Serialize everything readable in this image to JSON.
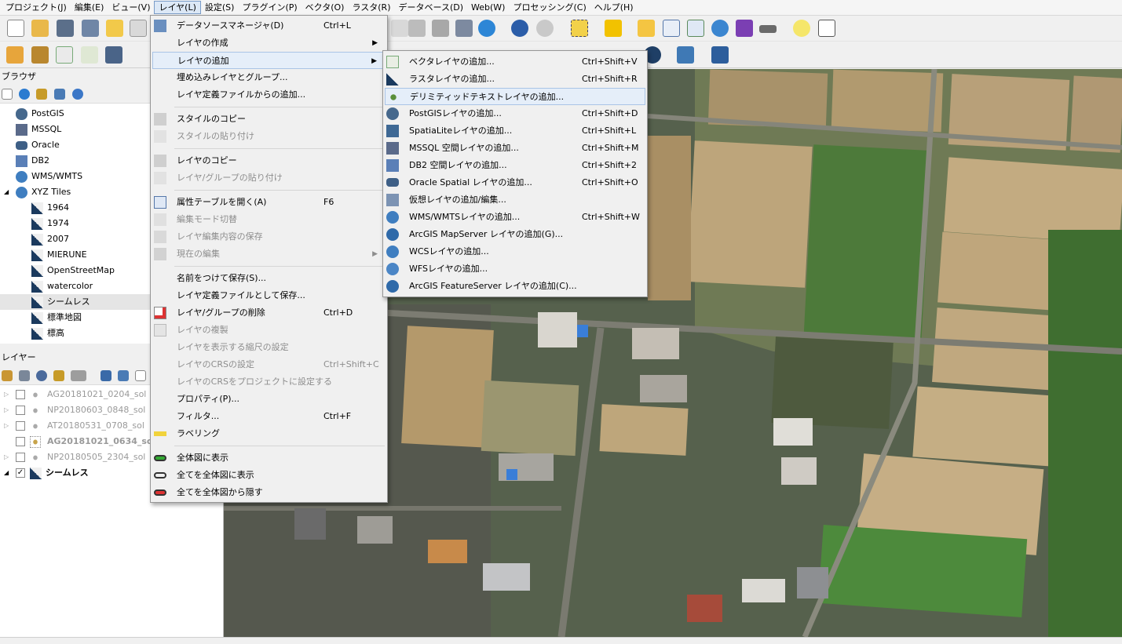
{
  "menubar": [
    "プロジェクト(J)",
    "編集(E)",
    "ビュー(V)",
    "レイヤ(L)",
    "設定(S)",
    "プラグイン(P)",
    "ベクタ(O)",
    "ラスタ(R)",
    "データベース(D)",
    "Web(W)",
    "プロセッシング(C)",
    "ヘルプ(H)"
  ],
  "browser": {
    "title": "ブラウザ",
    "items": [
      {
        "label": "PostGIS",
        "icon": "postgis-icon"
      },
      {
        "label": "MSSQL",
        "icon": "mssql-icon"
      },
      {
        "label": "Oracle",
        "icon": "oracle-icon"
      },
      {
        "label": "DB2",
        "icon": "db2-icon"
      },
      {
        "label": "WMS/WMTS",
        "icon": "globe-icon"
      },
      {
        "label": "XYZ Tiles",
        "icon": "globe-icon"
      },
      {
        "label": "1964",
        "icon": "tile-icon"
      },
      {
        "label": "1974",
        "icon": "tile-icon"
      },
      {
        "label": "2007",
        "icon": "tile-icon"
      },
      {
        "label": "MIERUNE",
        "icon": "tile-icon"
      },
      {
        "label": "OpenStreetMap",
        "icon": "tile-icon"
      },
      {
        "label": "watercolor",
        "icon": "tile-icon"
      },
      {
        "label": "シームレス",
        "icon": "tile-icon"
      },
      {
        "label": "標準地図",
        "icon": "tile-icon"
      },
      {
        "label": "標高",
        "icon": "tile-icon"
      }
    ]
  },
  "layers": {
    "title": "レイヤー",
    "items": [
      {
        "label": "AG20181021_0204_sol"
      },
      {
        "label": "NP20180603_0848_sol"
      },
      {
        "label": "AT20180531_0708_sol"
      },
      {
        "label": "AG20181021_0634_sol"
      },
      {
        "label": "NP20180505_2304_sol"
      },
      {
        "label": "シームレス",
        "checked": "✓"
      }
    ]
  },
  "layer_menu": [
    {
      "label": "データソースマネージャ(D)",
      "shortcut": "Ctrl+L",
      "icon": "datasource-icon"
    },
    {
      "label": "レイヤの作成",
      "shortcut": "",
      "arrow": "▶"
    },
    {
      "label": "レイヤの追加",
      "shortcut": "",
      "arrow": "▶"
    },
    {
      "label": "埋め込みレイヤとグループ...",
      "shortcut": ""
    },
    {
      "label": "レイヤ定義ファイルからの追加...",
      "shortcut": ""
    },
    {
      "label": "スタイルのコピー",
      "shortcut": ""
    },
    {
      "label": "スタイルの貼り付け",
      "shortcut": ""
    },
    {
      "label": "レイヤのコピー",
      "shortcut": ""
    },
    {
      "label": "レイヤ/グループの貼り付け",
      "shortcut": ""
    },
    {
      "label": "属性テーブルを開く(A)",
      "shortcut": "F6"
    },
    {
      "label": "編集モード切替",
      "shortcut": ""
    },
    {
      "label": "レイヤ編集内容の保存",
      "shortcut": ""
    },
    {
      "label": "現在の編集",
      "shortcut": "",
      "arrow": "▶"
    },
    {
      "label": "名前をつけて保存(S)...",
      "shortcut": ""
    },
    {
      "label": "レイヤ定義ファイルとして保存...",
      "shortcut": ""
    },
    {
      "label": "レイヤ/グループの削除",
      "shortcut": "Ctrl+D"
    },
    {
      "label": "レイヤの複製",
      "shortcut": ""
    },
    {
      "label": "レイヤを表示する縮尺の設定",
      "shortcut": ""
    },
    {
      "label": "レイヤのCRSの設定",
      "shortcut": "Ctrl+Shift+C"
    },
    {
      "label": "レイヤのCRSをプロジェクトに設定する",
      "shortcut": ""
    },
    {
      "label": "プロパティ(P)...",
      "shortcut": ""
    },
    {
      "label": "フィルタ...",
      "shortcut": "Ctrl+F"
    },
    {
      "label": "ラベリング",
      "shortcut": ""
    },
    {
      "label": "全体図に表示",
      "shortcut": ""
    },
    {
      "label": "全てを全体図に表示",
      "shortcut": ""
    },
    {
      "label": "全てを全体図から隠す",
      "shortcut": ""
    }
  ],
  "add_layer_menu": [
    {
      "label": "ベクタレイヤの追加...",
      "shortcut": "Ctrl+Shift+V"
    },
    {
      "label": "ラスタレイヤの追加...",
      "shortcut": "Ctrl+Shift+R"
    },
    {
      "label": "デリミティッドテキストレイヤの追加...",
      "shortcut": ""
    },
    {
      "label": "PostGISレイヤの追加...",
      "shortcut": "Ctrl+Shift+D"
    },
    {
      "label": "SpatiaLiteレイヤの追加...",
      "shortcut": "Ctrl+Shift+L"
    },
    {
      "label": "MSSQL 空間レイヤの追加...",
      "shortcut": "Ctrl+Shift+M"
    },
    {
      "label": "DB2 空間レイヤの追加...",
      "shortcut": "Ctrl+Shift+2"
    },
    {
      "label": "Oracle Spatial レイヤの追加...",
      "shortcut": "Ctrl+Shift+O"
    },
    {
      "label": "仮想レイヤの追加/編集...",
      "shortcut": ""
    },
    {
      "label": "WMS/WMTSレイヤの追加...",
      "shortcut": "Ctrl+Shift+W"
    },
    {
      "label": "ArcGIS MapServer レイヤの追加(G)...",
      "shortcut": ""
    },
    {
      "label": "WCSレイヤの追加...",
      "shortcut": ""
    },
    {
      "label": "WFSレイヤの追加...",
      "shortcut": ""
    },
    {
      "label": "ArcGIS FeatureServer レイヤの追加(C)...",
      "shortcut": ""
    }
  ],
  "colors": {
    "highlight": "#e5eef9",
    "menu_bg": "#f0f0f0",
    "disabled": "#8d8d8d"
  }
}
